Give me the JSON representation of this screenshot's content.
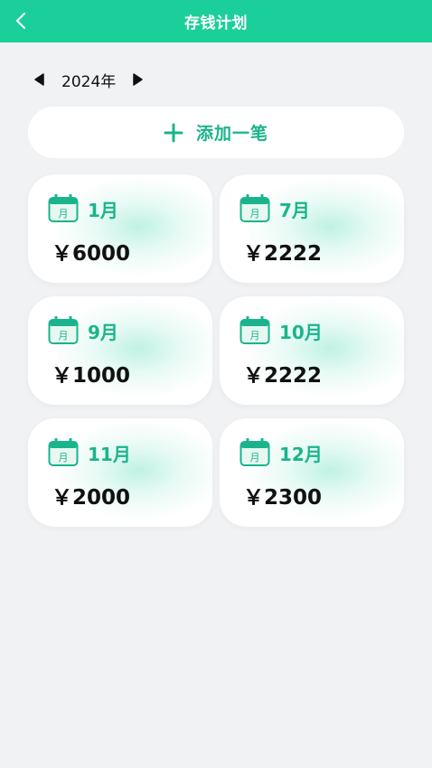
{
  "header": {
    "title": "存钱计划",
    "back_icon": "chevron-left-icon"
  },
  "year_selector": {
    "year": "2024年",
    "prev_icon": "triangle-left-icon",
    "next_icon": "triangle-right-icon"
  },
  "add_button": {
    "label": "添加一笔",
    "icon": "plus-icon"
  },
  "cards": [
    {
      "month": "1月",
      "amount": "￥6000",
      "icon": "calendar-icon",
      "icon_text": "月"
    },
    {
      "month": "7月",
      "amount": "￥2222",
      "icon": "calendar-icon",
      "icon_text": "月"
    },
    {
      "month": "9月",
      "amount": "￥1000",
      "icon": "calendar-icon",
      "icon_text": "月"
    },
    {
      "month": "10月",
      "amount": "￥2222",
      "icon": "calendar-icon",
      "icon_text": "月"
    },
    {
      "month": "11月",
      "amount": "￥2000",
      "icon": "calendar-icon",
      "icon_text": "月"
    },
    {
      "month": "12月",
      "amount": "￥2300",
      "icon": "calendar-icon",
      "icon_text": "月"
    }
  ],
  "colors": {
    "accent": "#1bcf9b",
    "accent_text": "#1ab48c",
    "background": "#f1f2f4"
  }
}
